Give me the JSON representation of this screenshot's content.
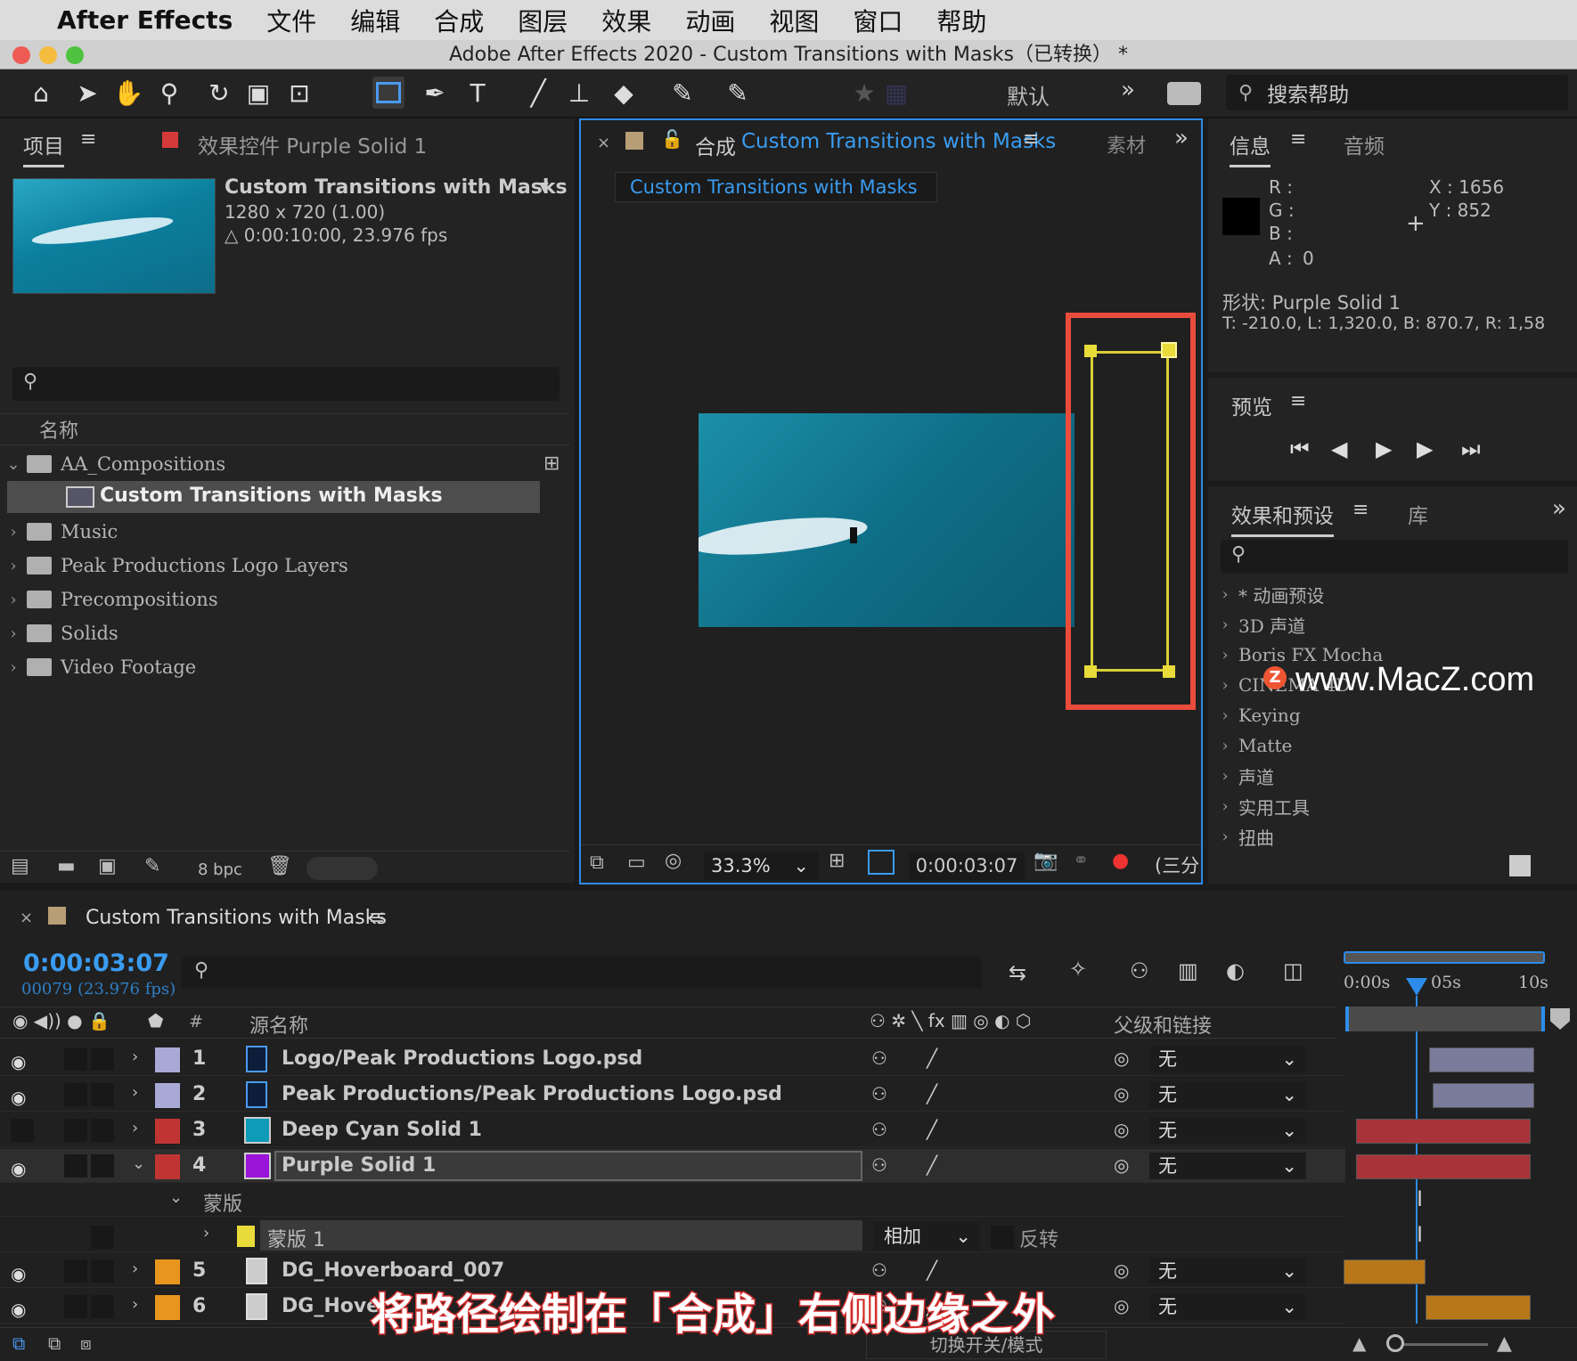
{
  "menubar": {
    "app_name": "After Effects",
    "items": [
      "文件",
      "编辑",
      "合成",
      "图层",
      "效果",
      "动画",
      "视图",
      "窗口",
      "帮助"
    ]
  },
  "window_title": "Adobe After Effects 2020 - Custom Transitions with Masks（已转换） *",
  "toolbar": {
    "workspace": "默认",
    "search_help_placeholder": "搜索帮助",
    "icons": [
      "home-icon",
      "selection-icon",
      "hand-icon",
      "zoom-icon",
      "rotate-icon",
      "camera-icon",
      "pan-behind-icon",
      "rectangle-tool-icon",
      "pen-icon",
      "type-icon",
      "brush-icon",
      "clone-stamp-icon",
      "eraser-icon",
      "roto-brush-icon",
      "puppet-pin-icon"
    ]
  },
  "project_panel": {
    "tab_label": "项目",
    "effects_tab_label": "效果控件 Purple Solid 1",
    "comp_name": "Custom Transitions with Masks",
    "comp_dimensions": "1280 x 720 (1.00)",
    "comp_duration": "△ 0:00:10:00, 23.976 fps",
    "column_name": "名称",
    "bpc": "8 bpc",
    "items": [
      {
        "label": "AA_Compositions",
        "type": "folder",
        "expanded": true
      },
      {
        "label": "Custom Transitions with Masks",
        "type": "comp",
        "selected": true
      },
      {
        "label": "Music",
        "type": "folder"
      },
      {
        "label": "Peak Productions Logo Layers",
        "type": "folder"
      },
      {
        "label": "Precompositions",
        "type": "folder"
      },
      {
        "label": "Solids",
        "type": "folder"
      },
      {
        "label": "Video Footage",
        "type": "folder"
      }
    ]
  },
  "comp_panel": {
    "tab_prefix": "合成",
    "tab_name": "Custom Transitions with Masks",
    "other_tab": "素材",
    "breadcrumb": "Custom Transitions with Masks",
    "zoom": "33.3%",
    "timecode": "0:00:03:07",
    "view_mode": "(三分"
  },
  "info_panel": {
    "tab_label": "信息",
    "audio_tab": "音频",
    "r_label": "R :",
    "g_label": "G :",
    "b_label": "B :",
    "a_label": "A :",
    "a_value": "0",
    "x_readout": "X : 1656",
    "y_readout": "Y :  852",
    "shape_label": "形状: Purple Solid 1",
    "bounds": "T: -210.0,   L: 1,320.0,   B: 870.7,   R: 1,58"
  },
  "preview_panel": {
    "tab_label": "预览"
  },
  "effects_panel": {
    "tab_label": "效果和预设",
    "lib_tab": "库",
    "items": [
      "* 动画预设",
      "3D 声道",
      "Boris FX Mocha",
      "CINEMA 4D",
      "Keying",
      "Matte",
      "声道",
      "实用工具",
      "扭曲"
    ]
  },
  "watermark": "www.MacZ.com",
  "timeline": {
    "tab_name": "Custom Transitions with Masks",
    "timecode": "0:00:03:07",
    "frame_info": "00079 (23.976 fps)",
    "col_source": "源名称",
    "col_parent": "父级和链接",
    "ruler_labels": [
      "0:00s",
      "05s",
      "10s"
    ],
    "switch_mode": "切换开关/模式",
    "layers": [
      {
        "num": "1",
        "name": "Logo/Peak Productions Logo.psd",
        "color": "#a9a9d6",
        "parent": "无",
        "visible": true
      },
      {
        "num": "2",
        "name": "Peak Productions/Peak Productions Logo.psd",
        "color": "#a9a9d6",
        "parent": "无",
        "visible": true
      },
      {
        "num": "3",
        "name": "Deep Cyan Solid 1",
        "color": "#c03434",
        "parent": "无",
        "visible": false
      },
      {
        "num": "4",
        "name": "Purple Solid 1",
        "color": "#c03434",
        "parent": "无",
        "visible": true
      },
      {
        "num": "5",
        "name": "DG_Hoverboard_007",
        "color": "#e8951e",
        "parent": "无",
        "visible": true
      },
      {
        "num": "6",
        "name": "DG_Hove",
        "color": "#e8951e",
        "parent": "无",
        "visible": true
      }
    ],
    "mask_group_label": "蒙版",
    "mask_name": "蒙版 1",
    "mask_mode": "相加",
    "mask_invert": "反转"
  },
  "subtitle": "将路径绘制在「合成」右侧边缘之外"
}
